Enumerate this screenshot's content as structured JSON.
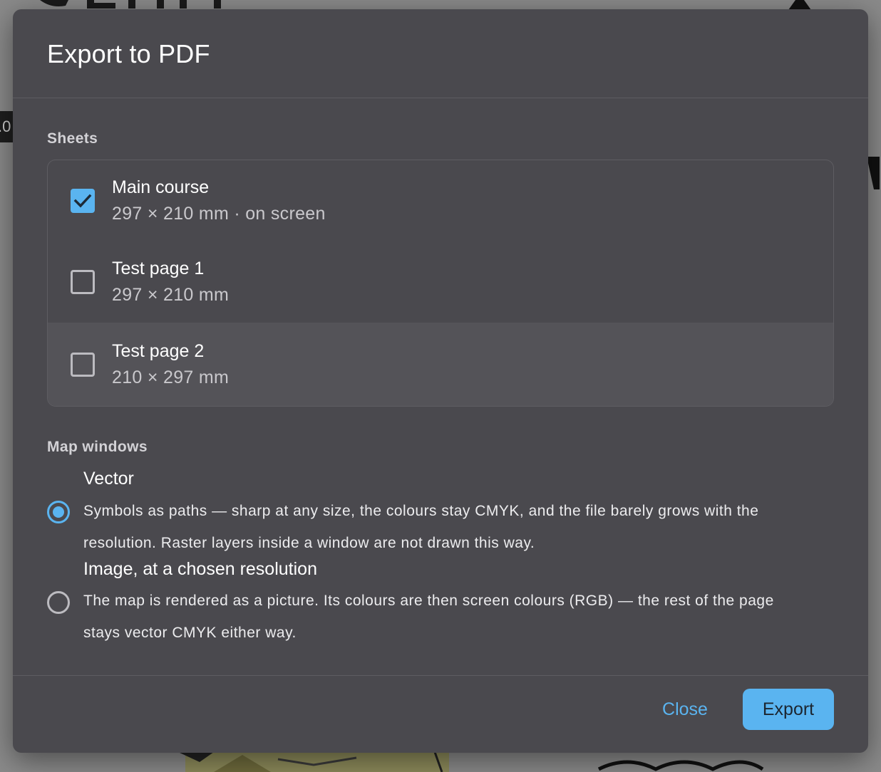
{
  "background": {
    "left_chip_text": ".0"
  },
  "dialog": {
    "title": "Export to PDF"
  },
  "sheets": {
    "label": "Sheets",
    "items": [
      {
        "name": "Main course",
        "meta": "297 × 210 mm · on screen",
        "checked": true
      },
      {
        "name": "Test page 1",
        "meta": "297 × 210 mm",
        "checked": false
      },
      {
        "name": "Test page 2",
        "meta": "210 × 297 mm",
        "checked": false
      }
    ]
  },
  "map_windows": {
    "label": "Map windows",
    "options": [
      {
        "title": "Vector",
        "description": "Symbols as paths — sharp at any size, the colours stay CMYK, and the file barely grows with the resolution. Raster layers inside a window are not drawn this way.",
        "selected": true
      },
      {
        "title": "Image, at a chosen resolution",
        "description": "The map is rendered as a picture. Its colours are then screen colours (RGB) — the rest of the page stays vector CMYK either way.",
        "selected": false
      }
    ]
  },
  "footer": {
    "close_label": "Close",
    "export_label": "Export"
  },
  "colors": {
    "accent": "#5ab4f0",
    "dialog_bg": "#4a494e",
    "backdrop": "#8a8a8a"
  },
  "icons": {
    "checkbox_checked": "check-icon"
  }
}
